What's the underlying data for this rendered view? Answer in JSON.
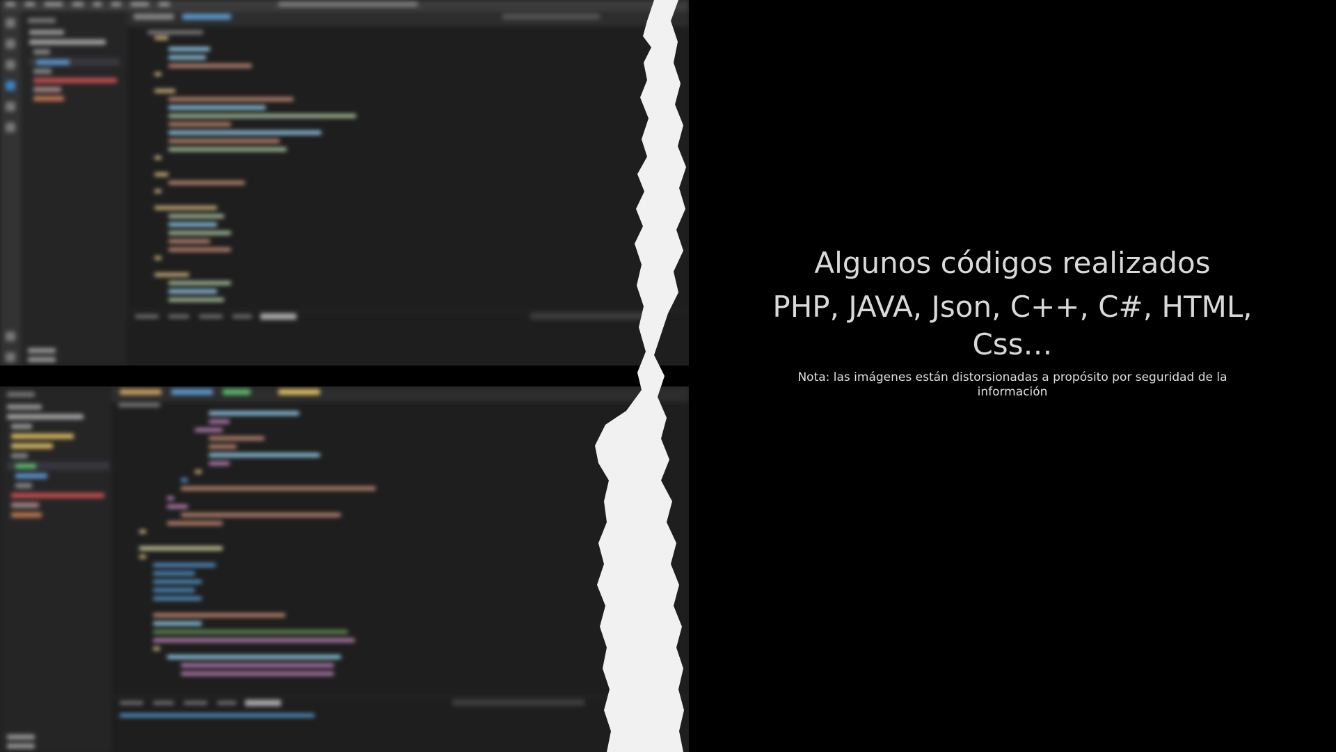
{
  "slide": {
    "title": "Algunos códigos realizados",
    "languages": "PHP, JAVA, Json, C++, C#, HTML, Css…",
    "note": "Nota: las imágenes están distorsionadas a propósito por seguridad de la información"
  },
  "colors": {
    "background": "#000000",
    "text": "#d9d9d9",
    "editor_bg": "#1e1e1e",
    "sidebar_bg": "#252526",
    "activity_bar": "#333333",
    "torn_paper": "#f2f2f2"
  },
  "screenshots": [
    {
      "description_label": "editor-screenshot-top",
      "blurred": true
    },
    {
      "description_label": "editor-screenshot-bottom",
      "blurred": true
    }
  ]
}
